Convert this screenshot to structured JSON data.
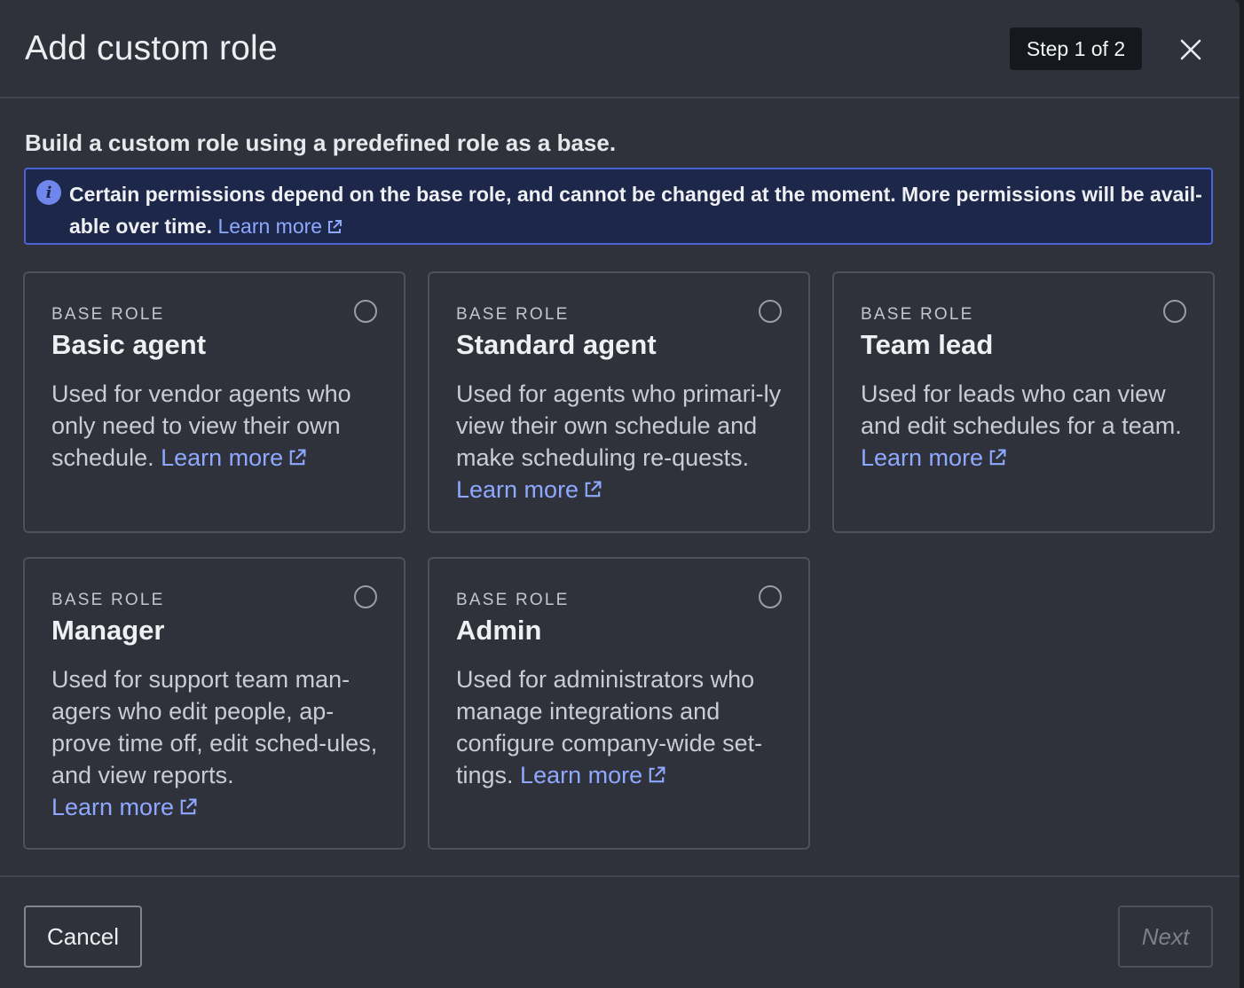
{
  "dialog": {
    "title": "Add custom role",
    "step": "Step 1 of 2",
    "close_icon": "close-icon"
  },
  "intro": {
    "subtitle": "Build a custom role using a predefined role as a base.",
    "notice_text": "Certain permissions depend on the base role, and cannot be changed at the moment. More permissions will be avail-able over time.",
    "notice_link": "Learn more",
    "notice_icon": "info-icon"
  },
  "roles": [
    {
      "eyebrow": "BASE ROLE",
      "title": "Basic agent",
      "description": "Used for vendor agents who only need to view their own schedule.",
      "link": "Learn more",
      "selected": false
    },
    {
      "eyebrow": "BASE ROLE",
      "title": "Standard agent",
      "description": "Used for agents who primari-ly view their own schedule and make scheduling re-quests.",
      "link": "Learn more",
      "selected": false
    },
    {
      "eyebrow": "BASE ROLE",
      "title": "Team lead",
      "description": "Used for leads who can view and edit schedules for a team.",
      "link": "Learn more",
      "selected": false
    },
    {
      "eyebrow": "BASE ROLE",
      "title": "Manager",
      "description": "Used for support team man-agers who edit people, ap-prove time off, edit sched-ules, and view reports.",
      "link": "Learn more",
      "selected": false
    },
    {
      "eyebrow": "BASE ROLE",
      "title": "Admin",
      "description": "Used for administrators who manage integrations and configure company-wide set-tings.",
      "link": "Learn more",
      "selected": false
    }
  ],
  "footer": {
    "cancel_label": "Cancel",
    "next_label": "Next",
    "next_enabled": false
  },
  "colors": {
    "modal_bg": "#2f323b",
    "link": "#8ea8ff",
    "notice_border": "#4a64d8",
    "notice_bg": "#1d2749"
  }
}
